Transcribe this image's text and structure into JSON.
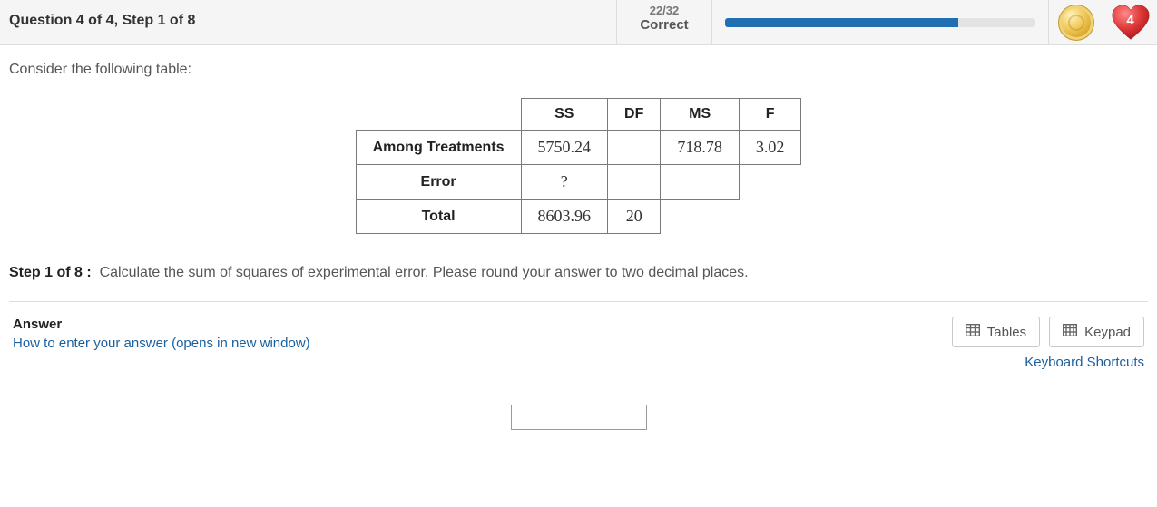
{
  "header": {
    "question_label": "Question 4 of 4, Step 1 of 8",
    "score": "22/32",
    "correct_label": "Correct",
    "progress_pct": 75,
    "hearts": "4"
  },
  "prompt": "Consider the following table:",
  "table": {
    "cols": [
      "SS",
      "DF",
      "MS",
      "F"
    ],
    "rows": [
      {
        "label": "Among Treatments",
        "ss": "5750.24",
        "df": "",
        "ms": "718.78",
        "f": "3.02"
      },
      {
        "label": "Error",
        "ss": "?",
        "df": "",
        "ms": "",
        "f": ""
      },
      {
        "label": "Total",
        "ss": "8603.96",
        "df": "20",
        "ms": "",
        "f": ""
      }
    ]
  },
  "step": {
    "label": "Step 1 of 8 :",
    "text": "Calculate the sum of squares of experimental error. Please round your answer to two decimal places."
  },
  "answer": {
    "label": "Answer",
    "howto": "How to enter your answer (opens in new window)",
    "tables_btn": "Tables",
    "keypad_btn": "Keypad",
    "shortcuts": "Keyboard Shortcuts",
    "input_value": ""
  }
}
